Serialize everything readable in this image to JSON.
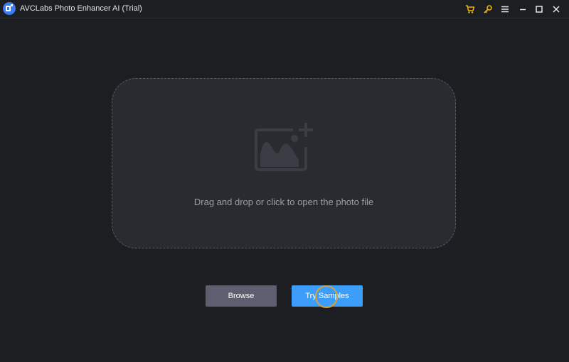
{
  "window": {
    "title": "AVCLabs Photo Enhancer AI (Trial)",
    "icons": [
      "app-logo-icon",
      "cart-icon",
      "key-icon",
      "menu-icon",
      "minimize-icon",
      "maximize-icon",
      "close-icon"
    ]
  },
  "colors": {
    "background": "#1d1e22",
    "dropzone": "#2a2b30",
    "accent": "#3d9dfb",
    "browse": "#5d5f70",
    "highlight": "#f5b400"
  },
  "dropzone": {
    "hint": "Drag and drop or click to open the photo file",
    "icon": "add-photo-icon"
  },
  "actions": {
    "browse_label": "Browse",
    "samples_label": "Try Samples"
  }
}
